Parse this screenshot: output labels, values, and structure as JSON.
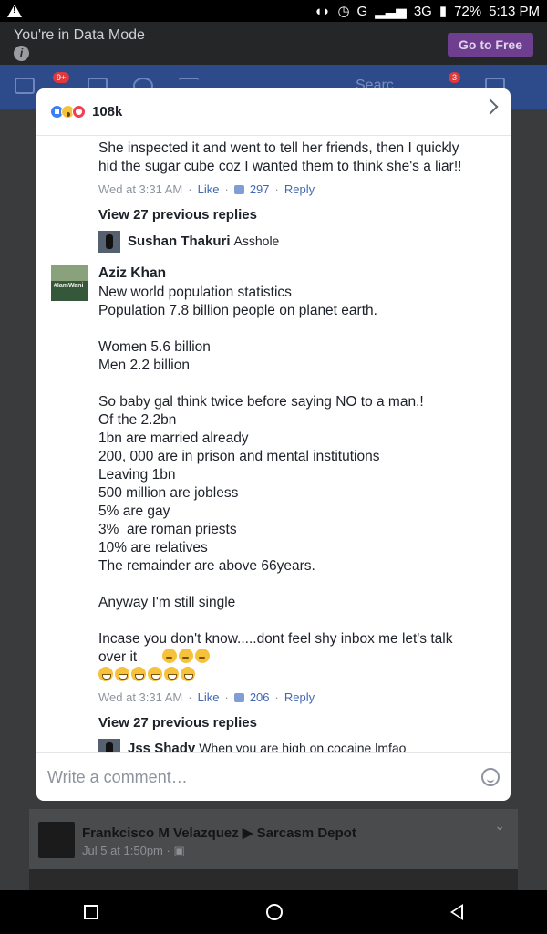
{
  "status_bar": {
    "battery": "72%",
    "time": "5:13 PM",
    "network": "G",
    "network2": "3G"
  },
  "data_mode": {
    "text": "You're in Data Mode",
    "button": "Go to Free"
  },
  "fb_bar": {
    "badge_notifications": "9+",
    "badge_messages": "3",
    "search_partial": "Searc"
  },
  "modal": {
    "reaction_count": "108k",
    "comments": {
      "c1_text": "She inspected it and went to tell her friends, then I quickly\nhid the sugar cube coz I wanted them to think she's a liar!!",
      "c1_time": "Wed at 3:31 AM",
      "c1_like": "Like",
      "c1_likes": "297",
      "c1_reply": "Reply",
      "c1_view_prev": "View 27 previous replies",
      "c1_reply_name": "Sushan Thakuri",
      "c1_reply_text": "Asshole",
      "c2_avatar_tag": "#IamWani",
      "c2_name": "Aziz Khan",
      "c2_text": "New world population statistics\nPopulation 7.8 billion people on planet earth.\n\nWomen 5.6 billion\nMen 2.2 billion\n\nSo baby gal think twice before saying NO to a man.!\nOf the 2.2bn\n1bn are married already\n200, 000 are in prison and mental institutions\nLeaving 1bn\n500 million are jobless\n5% are gay\n3%  are roman priests\n10% are relatives\nThe remainder are above 66years.\n\nAnyway I'm still single\n\nIncase you don't know.....dont feel shy inbox me let's talk\nover it",
      "c2_time": "Wed at 3:31 AM",
      "c2_like": "Like",
      "c2_likes": "206",
      "c2_reply": "Reply",
      "c2_view_prev": "View 27 previous replies",
      "c2_reply_name": "Jss Shady",
      "c2_reply_text": "When you are high on cocaine lmfao"
    },
    "comment_placeholder": "Write a comment…"
  },
  "background_post": {
    "author": "Frankcisco M Velazquez",
    "page": "Sarcasm Depot",
    "time": "Jul 5 at 1:50pm"
  }
}
